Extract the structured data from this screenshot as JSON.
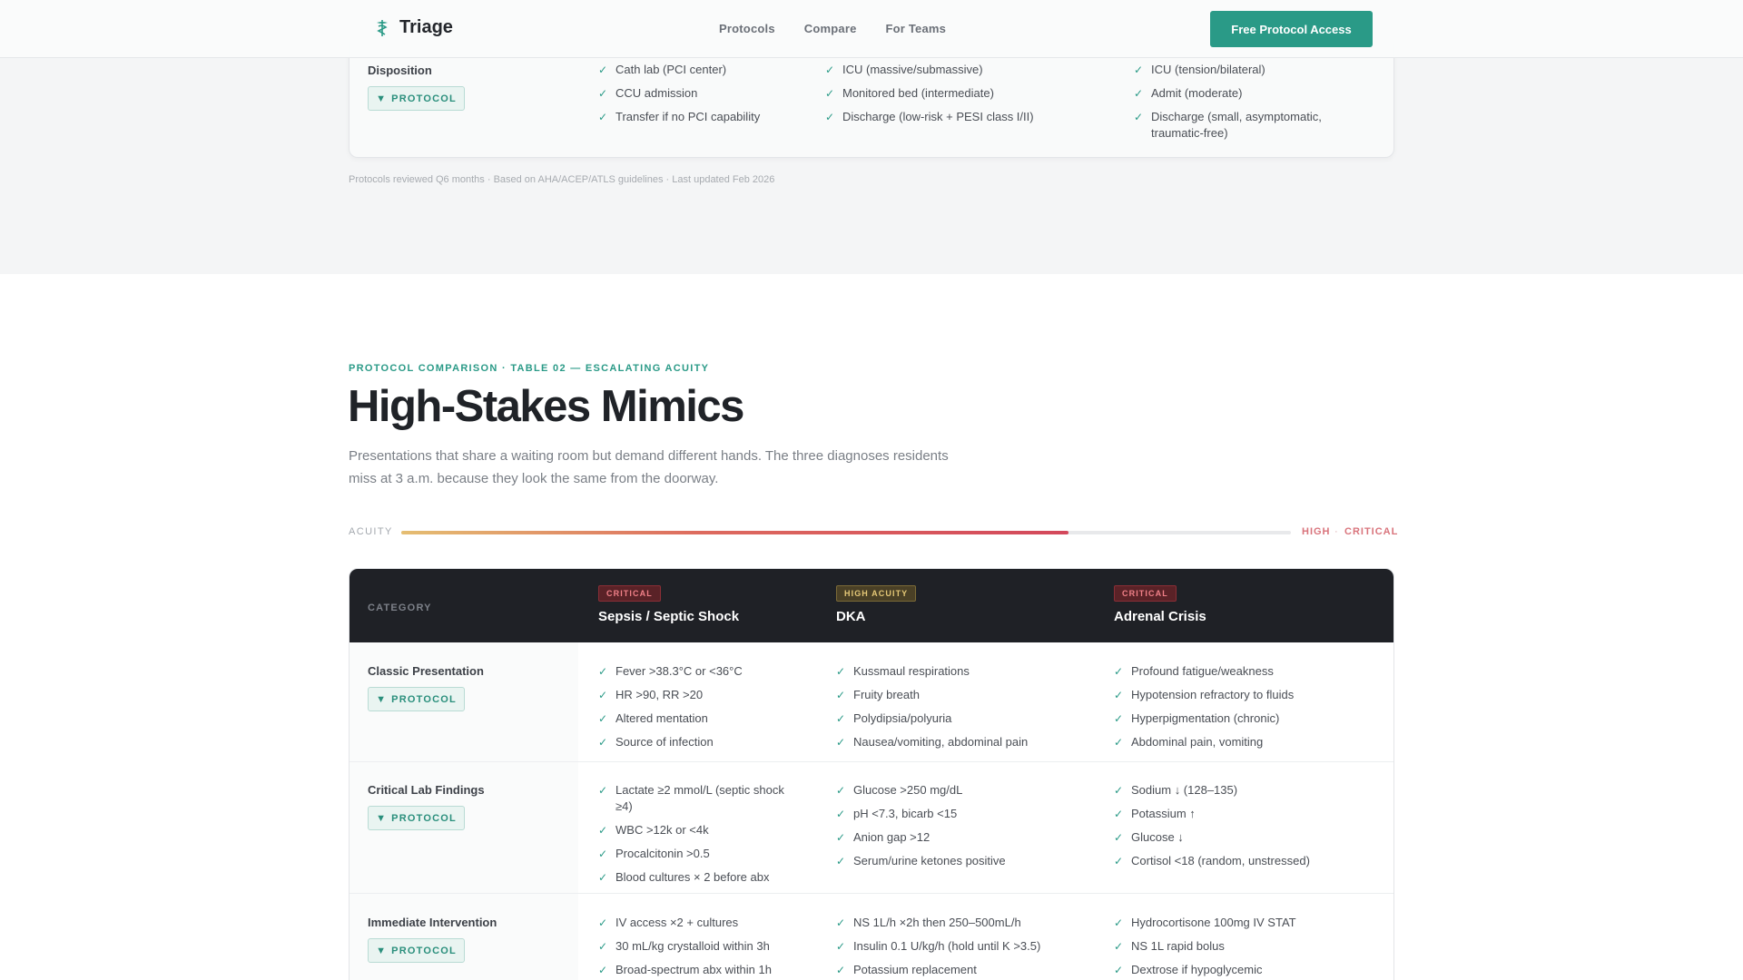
{
  "header": {
    "brand": "Triage",
    "nav": [
      "Protocols",
      "Compare",
      "For Teams"
    ],
    "cta": "Free Protocol Access"
  },
  "prev_table": {
    "row": {
      "category": "Disposition",
      "protocol_label": "PROTOCOL",
      "cols": [
        [
          "Cath lab (PCI center)",
          "CCU admission",
          "Transfer if no PCI capability"
        ],
        [
          "ICU (massive/submassive)",
          "Monitored bed (intermediate)",
          "Discharge (low-risk + PESI class I/II)"
        ],
        [
          "ICU (tension/bilateral)",
          "Admit (moderate)",
          "Discharge (small, asymptomatic, traumatic-free)"
        ]
      ]
    },
    "footnote": "Protocols reviewed Q6 months · Based on AHA/ACEP/ATLS guidelines · Last updated Feb 2026"
  },
  "section": {
    "eyebrow": "PROTOCOL COMPARISON · TABLE 02 — ESCALATING ACUITY",
    "title": "High-Stakes Mimics",
    "lead": "Presentations that share a waiting room but demand different hands. The three diagnoses residents miss at 3 a.m. because they look the same from the doorway."
  },
  "acuity": {
    "label": "ACUITY",
    "level_fraction": 0.75,
    "high": "HIGH",
    "separator": "·",
    "critical": "CRITICAL"
  },
  "table": {
    "category_header": "CATEGORY",
    "columns": [
      {
        "badge": "CRITICAL",
        "badge_kind": "crit",
        "title": "Sepsis / Septic Shock"
      },
      {
        "badge": "HIGH ACUITY",
        "badge_kind": "high",
        "title": "DKA"
      },
      {
        "badge": "CRITICAL",
        "badge_kind": "crit",
        "title": "Adrenal Crisis"
      }
    ],
    "rows": [
      {
        "category": "Classic Presentation",
        "protocol_label": "PROTOCOL",
        "cols": [
          [
            "Fever >38.3°C or <36°C",
            "HR >90, RR >20",
            "Altered mentation",
            "Source of infection"
          ],
          [
            "Kussmaul respirations",
            "Fruity breath",
            "Polydipsia/polyuria",
            "Nausea/vomiting, abdominal pain"
          ],
          [
            "Profound fatigue/weakness",
            "Hypotension refractory to fluids",
            "Hyperpigmentation (chronic)",
            "Abdominal pain, vomiting"
          ]
        ]
      },
      {
        "category": "Critical Lab Findings",
        "protocol_label": "PROTOCOL",
        "cols": [
          [
            "Lactate ≥2 mmol/L (septic shock ≥4)",
            "WBC >12k or <4k",
            "Procalcitonin >0.5",
            "Blood cultures × 2 before abx"
          ],
          [
            "Glucose >250 mg/dL",
            "pH <7.3, bicarb <15",
            "Anion gap >12",
            "Serum/urine ketones positive"
          ],
          [
            "Sodium ↓ (128–135)",
            "Potassium ↑",
            "Glucose ↓",
            "Cortisol <18 (random, unstressed)"
          ]
        ]
      },
      {
        "category": "Immediate Intervention",
        "protocol_label": "PROTOCOL",
        "cols": [
          [
            "IV access ×2 + cultures",
            "30 mL/kg crystalloid within 3h",
            "Broad-spectrum abx within 1h"
          ],
          [
            "NS 1L/h ×2h then 250–500mL/h",
            "Insulin 0.1 U/kg/h (hold until K >3.5)",
            "Potassium replacement"
          ],
          [
            "Hydrocortisone 100mg IV STAT",
            "NS 1L rapid bolus",
            "Dextrose if hypoglycemic"
          ]
        ]
      }
    ]
  },
  "colors": {
    "accent": "#2a9a87",
    "dark_header": "#1f2126",
    "critical": "#d9747c"
  }
}
